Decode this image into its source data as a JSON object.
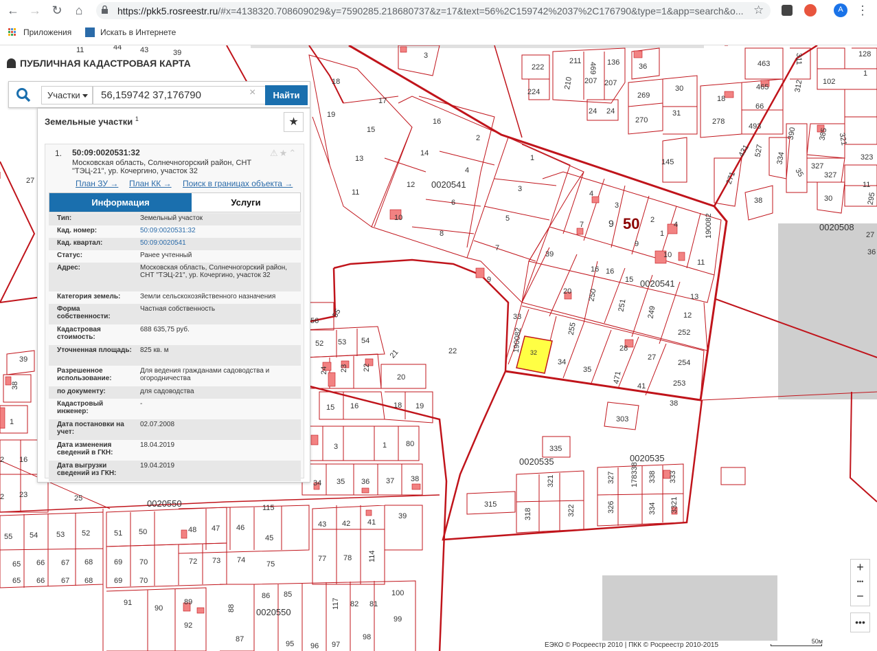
{
  "browser": {
    "url_host": "https://pkk5.rosreestr.ru",
    "url_rest": "/#x=4138320.708609029&y=7590285.218680737&z=17&text=56%2C159742%2037%2C176790&type=1&app=search&o...",
    "profile_initial": "A",
    "bookmarks": [
      "Приложения",
      "Искать в Интернете"
    ]
  },
  "app": {
    "logo": "ПУБЛИЧНАЯ КАДАСТРОВАЯ КАРТА"
  },
  "search": {
    "type_label": "Участки",
    "query": "56,159742 37,176790",
    "button": "Найти"
  },
  "panel": {
    "title": "Земельные участки",
    "count": "1",
    "card": {
      "index": "1.",
      "cad_number": "50:09:0020531:32",
      "address": "Московская область, Солнечногорский район, СНТ \"ТЭЦ-21\", ур. Кочергино, участок 32",
      "links": [
        "План ЗУ →",
        "План КК →",
        "Поиск в границах объекта →"
      ]
    },
    "tabs": [
      "Информация",
      "Услуги"
    ],
    "rows": [
      {
        "k": "Тип:",
        "v": "Земельный участок"
      },
      {
        "k": "Кад. номер:",
        "v": "50:09:0020531:32"
      },
      {
        "k": "Кад. квартал:",
        "v": "50:09:0020541"
      },
      {
        "k": "Статус:",
        "v": "Ранее учтенный"
      },
      {
        "k": "Адрес:",
        "v": "Московская область, Солнечногорский район, СНТ \"ТЭЦ-21\", ур. Кочергино, участок 32"
      },
      {
        "k": "Категория земель:",
        "v": "Земли сельскохозяйственного назначения"
      },
      {
        "k": "Форма собственности:",
        "v": "Частная собственность"
      },
      {
        "k": "Кадастровая стоимость:",
        "v": "688 635,75 руб."
      },
      {
        "k": "Уточненная площадь:",
        "v": "825 кв. м"
      },
      {
        "k": "Разрешенное использование:",
        "v": "Для ведения гражданами садоводства и огородничества"
      },
      {
        "k": "по документу:",
        "v": "для садоводства"
      },
      {
        "k": "Кадастровый инженер:",
        "v": "-"
      },
      {
        "k": "Дата постановки на учет:",
        "v": "02.07.2008"
      },
      {
        "k": "Дата изменения сведений в ГКН:",
        "v": "18.04.2019"
      },
      {
        "k": "Дата выгрузки сведений из ГКН:",
        "v": "19.04.2019"
      }
    ]
  },
  "map": {
    "quarters": [
      "0020541",
      "0020541",
      "0020508",
      "0020535",
      "0020535",
      "0020550",
      "0020550"
    ],
    "district": "50",
    "highlight_parcel": "32",
    "parcels": [
      "11",
      "44",
      "43",
      "39",
      "3",
      "222",
      "211",
      "469",
      "136",
      "36",
      "311",
      "463",
      "128",
      "1",
      "102",
      "224",
      "210",
      "207",
      "207",
      "30",
      "465",
      "312",
      "1",
      "18",
      "17",
      "24",
      "24",
      "269",
      "31",
      "18",
      "66",
      "16",
      "16",
      "2",
      "270",
      "278",
      "493",
      "385",
      "321",
      "19",
      "15",
      "14",
      "4",
      "145",
      "390",
      "327",
      "323",
      "13",
      "12",
      "6",
      "0020541",
      "1",
      "3",
      "431",
      "527",
      "35",
      "327",
      "11",
      "10",
      "8",
      "5",
      "7",
      "9",
      "4",
      "3",
      "2",
      "7",
      "1",
      "27",
      "39",
      "16",
      "16",
      "15",
      "13",
      "12",
      "9",
      "10",
      "11",
      "190082",
      "20",
      "250",
      "251",
      "249",
      "252",
      "33",
      "255",
      "28",
      "27",
      "254",
      "190082",
      "32",
      "34",
      "35",
      "471",
      "41",
      "253",
      "38",
      "303",
      "22",
      "56",
      "55",
      "52",
      "53",
      "54",
      "24",
      "23",
      "22",
      "21",
      "20",
      "15",
      "16",
      "18",
      "19",
      "3",
      "1",
      "80",
      "335",
      "315",
      "318",
      "321",
      "322",
      "327",
      "178338",
      "338",
      "333",
      "326",
      "334",
      "3321",
      "36",
      "37",
      "38",
      "34",
      "35",
      "25",
      "23",
      "16",
      "1",
      "115",
      "39",
      "43",
      "42",
      "41",
      "48",
      "47",
      "46",
      "45",
      "55",
      "54",
      "53",
      "52",
      "51",
      "50",
      "72",
      "73",
      "74",
      "75",
      "77",
      "78",
      "114",
      "65",
      "66",
      "67",
      "68",
      "69",
      "70",
      "86",
      "85",
      "88",
      "117",
      "82",
      "81",
      "100",
      "91",
      "90",
      "89",
      "92",
      "99",
      "98",
      "97",
      "96",
      "95",
      "38",
      "27",
      "36"
    ],
    "zoom_in": "+",
    "zoom_out": "−",
    "more": "•••",
    "attribution": "ЕЭКО © Росреестр 2010 | ПКК © Росреестр 2010-2015",
    "scale": "50м"
  },
  "colors": {
    "boundary": "#c0141b",
    "building": "#f28282",
    "highlight": "#ffff44",
    "accent": "#1a6fae",
    "grey_zone": "#cfcfcf"
  }
}
